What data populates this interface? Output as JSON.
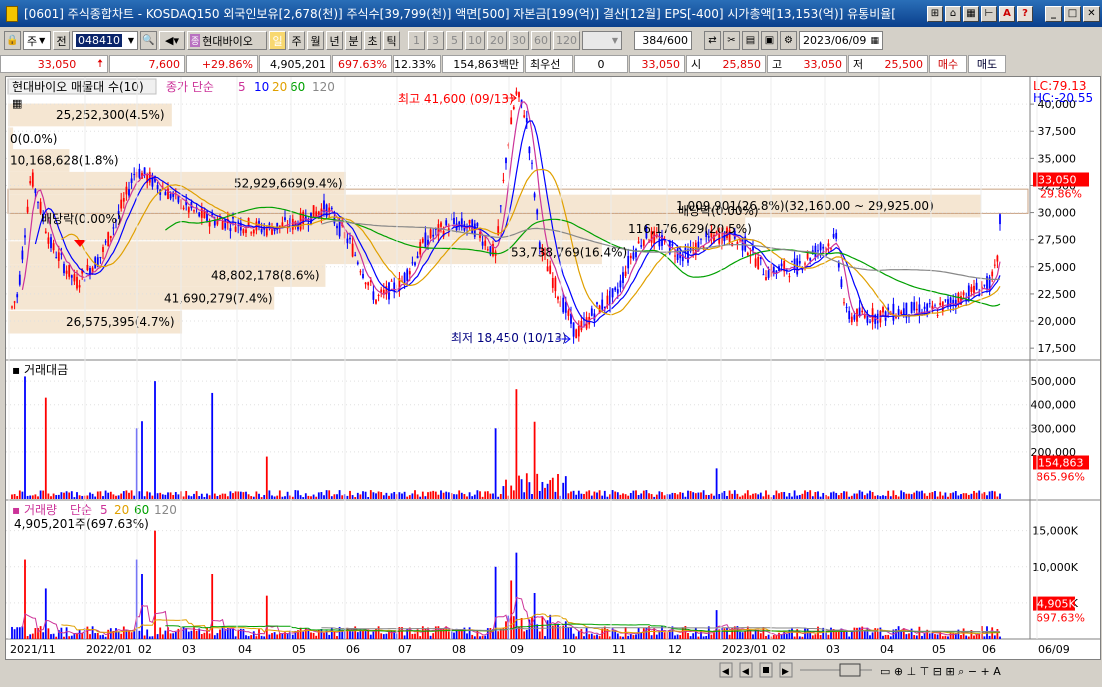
{
  "title": "[0601] 주식종합차트 - KOSDAQ150 외국인보유[2,678(천)] 주식수[39,799(천)] 액면[500] 자본금[199(억)] 결산[12월] EPS[-400] 시가총액[13,153(억)] 유통비율[",
  "toolbar": {
    "period_type": "주",
    "market": "전",
    "code": "048410",
    "name": "현대바이오",
    "button_il": "일",
    "periods": [
      "주",
      "월",
      "년",
      "분",
      "초",
      "틱"
    ],
    "intervals": [
      "1",
      "3",
      "5",
      "10",
      "20",
      "30",
      "60",
      "120"
    ],
    "count": "384",
    "count_total": "/600",
    "date": "2023/06/09"
  },
  "quote": {
    "price": "33,050",
    "change": "7,600",
    "change_pct": "+29.86%",
    "volume": "4,905,201",
    "volume_pct": "697.63%",
    "turnover": "12.33%",
    "amount": "154,863백만",
    "priority": "최우선",
    "priority_val": "0",
    "ask": "33,050",
    "open_label": "시",
    "open": "25,850",
    "high_label": "고",
    "high": "33,050",
    "low_label": "저",
    "low": "25,500",
    "buy": "매수",
    "sell": "매도"
  },
  "chart": {
    "price_panel": {
      "header": "현대바이오 매물대 수(10)",
      "ma_label": "종가 단순",
      "ma_periods": [
        "5",
        "10",
        "20",
        "60",
        "120"
      ],
      "ma_colors": [
        "#cc3399",
        "#0000ff",
        "#e0a000",
        "#00a000",
        "#888888"
      ],
      "lc": "LC:79.13",
      "hc": "HC:-20.55",
      "y_ticks": [
        "40,000",
        "37,500",
        "35,000",
        "32,500",
        "30,000",
        "27,500",
        "25,000",
        "22,500",
        "20,000",
        "17,500"
      ],
      "current_price": "33,050",
      "current_pct": "29.86%",
      "high_marker": "최고 41,600 (09/13)",
      "low_marker": "최저 18,450 (10/13)",
      "dividend_labels": [
        "배당락(0.00%)",
        "배당락(0.00%)"
      ],
      "volume_profile": [
        {
          "label": "25,252,300(4.5%)",
          "price": 39000,
          "width": 0.16
        },
        {
          "label": "0(0.0%)",
          "price": 36800,
          "width": 0.005
        },
        {
          "label": "10,168,628(1.8%)",
          "price": 34800,
          "width": 0.06
        },
        {
          "label": "52,929,669(9.4%)",
          "price": 32700,
          "width": 0.33
        },
        {
          "label": "1,009,901(26.8%)(32,160.00 ~ 29,925.00)",
          "price": 30600,
          "width": 0.95
        },
        {
          "label": "116,176,629(20.5%)",
          "price": 28500,
          "width": 0.72
        },
        {
          "label": "53,738,769(16.4%)",
          "price": 26300,
          "width": 0.58
        },
        {
          "label": "48,802,178(8.6%)",
          "price": 24200,
          "width": 0.31
        },
        {
          "label": "41,690,279(7.4%)",
          "price": 22100,
          "width": 0.26
        },
        {
          "label": "26,575,395(4.7%)",
          "price": 19900,
          "width": 0.17
        }
      ]
    },
    "amount_panel": {
      "title": "거래대금",
      "y_ticks": [
        "500,000",
        "400,000",
        "300,000",
        "200,000"
      ],
      "current": "154,863",
      "current_pct": "865.96%"
    },
    "volume_panel": {
      "title": "거래량",
      "ma_label": "단순",
      "ma_periods": [
        "5",
        "20",
        "60",
        "120"
      ],
      "current_text": "4,905,201주(697.63%)",
      "y_ticks": [
        "15,000K",
        "10,000K",
        "5,000K"
      ],
      "current": "4,905K",
      "current_pct": "697.63%"
    },
    "x_ticks": [
      "2021/11",
      "2022/01",
      "02",
      "03",
      "04",
      "05",
      "06",
      "07",
      "08",
      "09",
      "10",
      "11",
      "12",
      "2023/01",
      "02",
      "03",
      "04",
      "05",
      "06",
      "06/09"
    ]
  }
}
